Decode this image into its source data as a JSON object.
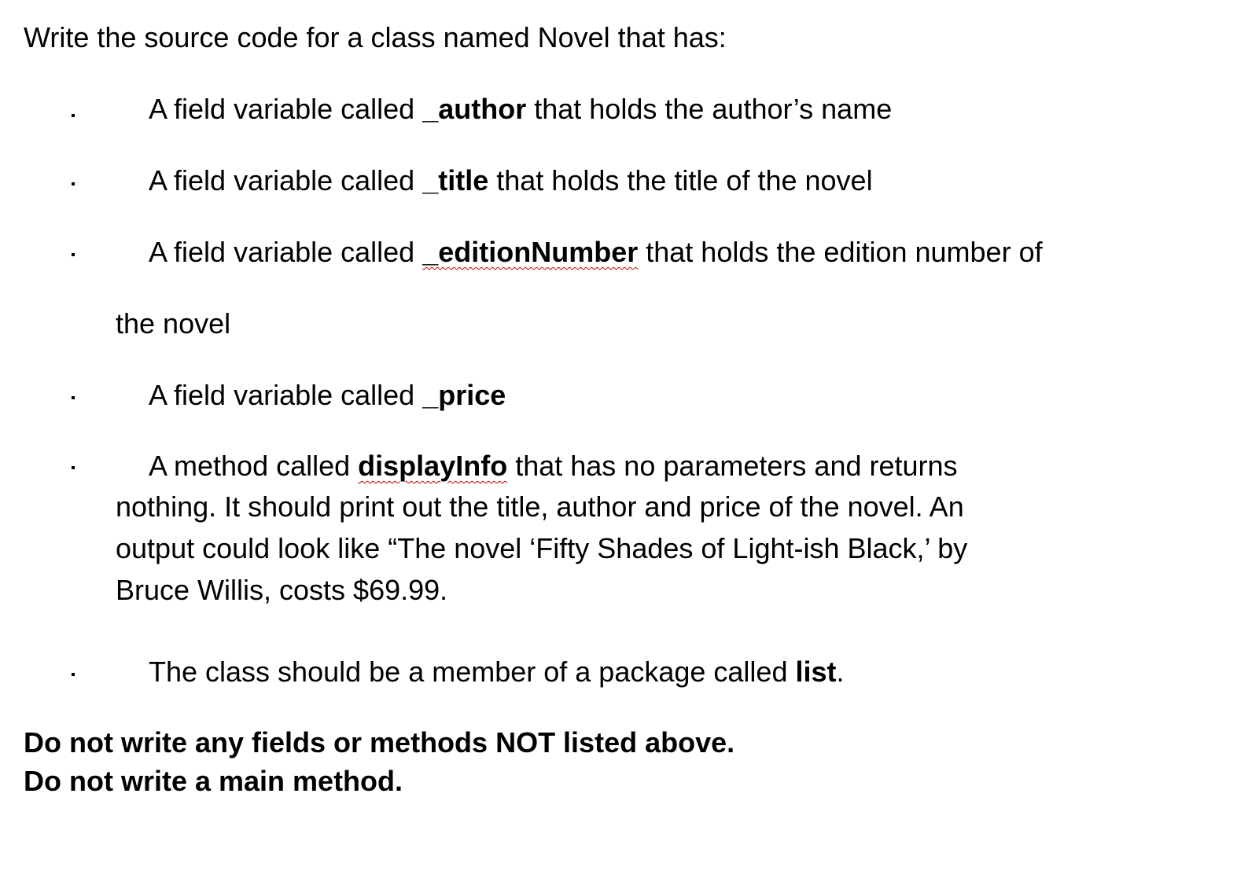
{
  "intro": "Write the source code for a class named Novel that has:",
  "items": [
    {
      "pre": "A field variable called ",
      "bold": "_author",
      "post": " that holds the author’s name"
    },
    {
      "pre": "A field variable called ",
      "bold": "_title",
      "post": " that holds the title of the novel"
    },
    {
      "pre": "A field variable called ",
      "bold": "_editionNumber",
      "post": " that holds the edition number of",
      "cont": "the novel"
    },
    {
      "pre": "A field variable called ",
      "bold": "_price",
      "post": ""
    },
    {
      "pre": "A method called ",
      "bold": "displayInfo",
      "post": " that has no parameters and returns",
      "lines": [
        "nothing. It should print out the title, author and price of the novel. An",
        "output could look like “The novel ‘Fifty Shades of Light-ish Black,’ by",
        "Bruce Willis, costs $69.99."
      ]
    },
    {
      "pre": "The class should be a member of a package called ",
      "bold": "list",
      "post": "."
    }
  ],
  "footer": [
    "Do not write any fields or methods NOT listed above.",
    "Do not write a main method."
  ]
}
